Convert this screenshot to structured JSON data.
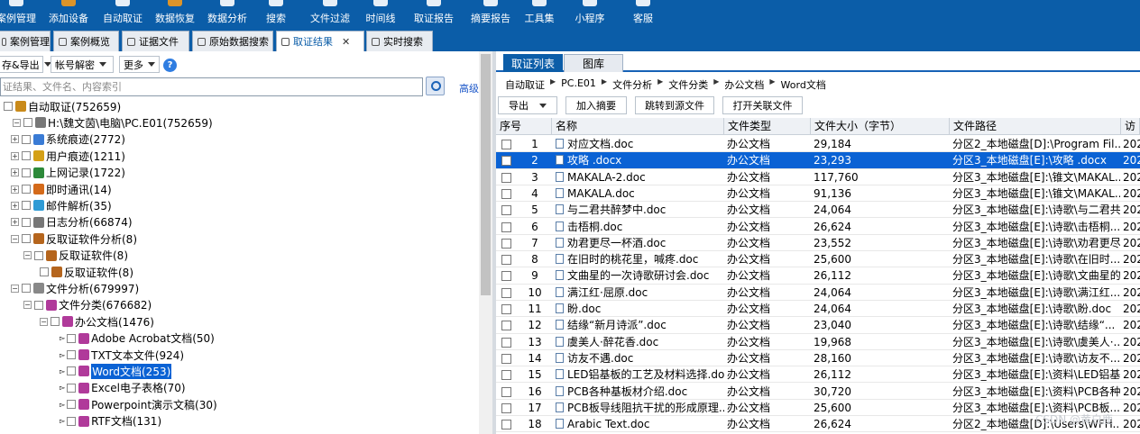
{
  "toolbar": {
    "items": [
      {
        "label": "案例管理"
      },
      {
        "label": "添加设备"
      },
      {
        "label": "自动取证"
      },
      {
        "label": "数据恢复"
      },
      {
        "label": "数据分析"
      },
      {
        "label": "搜索"
      },
      {
        "label": "文件过滤"
      },
      {
        "label": "时间线"
      },
      {
        "label": "取证报告"
      },
      {
        "label": "摘要报告"
      },
      {
        "label": "工具集"
      },
      {
        "label": "小程序"
      },
      {
        "label": "客服"
      }
    ]
  },
  "tabs": [
    {
      "label": "案例管理"
    },
    {
      "label": "案例概览"
    },
    {
      "label": "证据文件"
    },
    {
      "label": "原始数据搜索"
    },
    {
      "label": "取证结果",
      "close": "✕"
    },
    {
      "label": "实时搜索"
    }
  ],
  "left": {
    "export_label": "存&导出",
    "decrypt_label": "帐号解密",
    "more_label": "更多",
    "help": "?",
    "search_placeholder": "证结果、文件名、内容索引",
    "advanced": "高级",
    "tree": [
      {
        "label": "自动取证(752659)",
        "pm": "",
        "icon": "folder-icon",
        "color": "#c98a1a"
      },
      {
        "label": "H:\\魏文茵\\电脑\\PC.E01(752659)",
        "pm": "−",
        "icon": "disk-icon",
        "color": "#777"
      },
      {
        "label": "系统痕迹(2772)",
        "pm": "+",
        "icon": "system-trace-icon",
        "color": "#3a7bd5"
      },
      {
        "label": "用户痕迹(1211)",
        "pm": "+",
        "icon": "user-trace-icon",
        "color": "#d4a017"
      },
      {
        "label": "上网记录(1722)",
        "pm": "+",
        "icon": "globe-icon",
        "color": "#2d8a3a"
      },
      {
        "label": "即时通讯(14)",
        "pm": "+",
        "icon": "chat-icon",
        "color": "#d46a1a"
      },
      {
        "label": "邮件解析(35)",
        "pm": "+",
        "icon": "mail-icon",
        "color": "#2f9bd5"
      },
      {
        "label": "日志分析(66874)",
        "pm": "+",
        "icon": "log-icon",
        "color": "#777"
      },
      {
        "label": "反取证软件分析(8)",
        "pm": "−",
        "icon": "anti-forensics-icon",
        "color": "#b5651d"
      },
      {
        "label": "反取证软件(8)",
        "pm": "−",
        "icon": "anti-forensics-icon",
        "color": "#b5651d"
      },
      {
        "label": "反取证软件(8)",
        "pm": "",
        "icon": "anti-forensics-icon",
        "color": "#b5651d"
      },
      {
        "label": "文件分析(679997)",
        "pm": "−",
        "icon": "file-analysis-icon",
        "color": "#888"
      },
      {
        "label": "文件分类(676682)",
        "pm": "−",
        "icon": "file-category-icon",
        "color": "#b03a9a"
      },
      {
        "label": "办公文档(1476)",
        "pm": "−",
        "icon": "office-doc-icon",
        "color": "#b03a9a"
      },
      {
        "label": "Adobe Acrobat文档(50)",
        "pm": "",
        "icon": "pdf-icon",
        "color": "#b03a9a"
      },
      {
        "label": "TXT文本文件(924)",
        "pm": "",
        "icon": "txt-icon",
        "color": "#b03a9a"
      },
      {
        "label": "Word文档(253)",
        "pm": "",
        "icon": "word-icon",
        "color": "#b03a9a",
        "selected": true
      },
      {
        "label": "Excel电子表格(70)",
        "pm": "",
        "icon": "excel-icon",
        "color": "#b03a9a"
      },
      {
        "label": "Powerpoint演示文稿(30)",
        "pm": "",
        "icon": "ppt-icon",
        "color": "#b03a9a"
      },
      {
        "label": "RTF文档(131)",
        "pm": "",
        "icon": "rtf-icon",
        "color": "#b03a9a"
      }
    ]
  },
  "right": {
    "tabs": [
      {
        "label": "取证列表"
      },
      {
        "label": "图库"
      }
    ],
    "breadcrumb": [
      "自动取证",
      "PC.E01",
      "文件分析",
      "文件分类",
      "办公文档",
      "Word文档"
    ],
    "buttons": {
      "export": "导出",
      "add_summary": "加入摘要",
      "jump_source": "跳转到源文件",
      "open_linked": "打开关联文件"
    },
    "columns": [
      "序号",
      "名称",
      "文件类型",
      "文件大小（字节）",
      "文件路径",
      "访"
    ],
    "rows": [
      {
        "no": "1",
        "name": "对应文档.doc",
        "type": "办公文档",
        "size": "29,184",
        "path": "分区2_本地磁盘[D]:\\Program Fil...",
        "time": "202"
      },
      {
        "no": "2",
        "name": "攻略 .docx",
        "type": "办公文档",
        "size": "23,293",
        "path": "分区3_本地磁盘[E]:\\攻略 .docx",
        "time": "202",
        "selected": true
      },
      {
        "no": "3",
        "name": "MAKALA-2.doc",
        "type": "办公文档",
        "size": "117,760",
        "path": "分区3_本地磁盘[E]:\\锥文\\MAKAL...",
        "time": "202"
      },
      {
        "no": "4",
        "name": "MAKALA.doc",
        "type": "办公文档",
        "size": "91,136",
        "path": "分区3_本地磁盘[E]:\\锥文\\MAKAL...",
        "time": "202"
      },
      {
        "no": "5",
        "name": "与二君共醉梦中.doc",
        "type": "办公文档",
        "size": "24,064",
        "path": "分区3_本地磁盘[E]:\\诗歌\\与二君共...",
        "time": "202"
      },
      {
        "no": "6",
        "name": "击梧桐.doc",
        "type": "办公文档",
        "size": "26,624",
        "path": "分区3_本地磁盘[E]:\\诗歌\\击梧桐....",
        "time": "202"
      },
      {
        "no": "7",
        "name": "劝君更尽一杯酒.doc",
        "type": "办公文档",
        "size": "23,552",
        "path": "分区3_本地磁盘[E]:\\诗歌\\劝君更尽...",
        "time": "202"
      },
      {
        "no": "8",
        "name": "在旧时的桃花里，喊疼.doc",
        "type": "办公文档",
        "size": "25,600",
        "path": "分区3_本地磁盘[E]:\\诗歌\\在旧时...",
        "time": "202"
      },
      {
        "no": "9",
        "name": "文曲星的一次诗歌研讨会.doc",
        "type": "办公文档",
        "size": "26,112",
        "path": "分区3_本地磁盘[E]:\\诗歌\\文曲星的...",
        "time": "202"
      },
      {
        "no": "10",
        "name": "满江红·屈原.doc",
        "type": "办公文档",
        "size": "24,064",
        "path": "分区3_本地磁盘[E]:\\诗歌\\满江红...",
        "time": "202"
      },
      {
        "no": "11",
        "name": "盼.doc",
        "type": "办公文档",
        "size": "24,064",
        "path": "分区3_本地磁盘[E]:\\诗歌\\盼.doc",
        "time": "202"
      },
      {
        "no": "12",
        "name": "结缘“新月诗派”.doc",
        "type": "办公文档",
        "size": "23,040",
        "path": "分区3_本地磁盘[E]:\\诗歌\\结缘“...",
        "time": "202"
      },
      {
        "no": "13",
        "name": "虞美人·醉花香.doc",
        "type": "办公文档",
        "size": "19,968",
        "path": "分区3_本地磁盘[E]:\\诗歌\\虞美人·...",
        "time": "202"
      },
      {
        "no": "14",
        "name": "访友不遇.doc",
        "type": "办公文档",
        "size": "28,160",
        "path": "分区3_本地磁盘[E]:\\诗歌\\访友不...",
        "time": "202"
      },
      {
        "no": "15",
        "name": "LED铝基板的工艺及材料选择.doc",
        "type": "办公文档",
        "size": "26,112",
        "path": "分区3_本地磁盘[E]:\\资料\\LED铝基...",
        "time": "202"
      },
      {
        "no": "16",
        "name": "PCB各种基板材介绍.doc",
        "type": "办公文档",
        "size": "30,720",
        "path": "分区3_本地磁盘[E]:\\资料\\PCB各种...",
        "time": "202"
      },
      {
        "no": "17",
        "name": "PCB板导线阻抗干扰的形成原理....",
        "type": "办公文档",
        "size": "25,600",
        "path": "分区3_本地磁盘[E]:\\资料\\PCB板...",
        "time": "202"
      },
      {
        "no": "18",
        "name": "Arabic Text.doc",
        "type": "办公文档",
        "size": "26,624",
        "path": "分区2_本地磁盘[D]:\\Users\\WFH...",
        "time": "202"
      }
    ]
  },
  "watermark": "CSDN @黄白鹿"
}
